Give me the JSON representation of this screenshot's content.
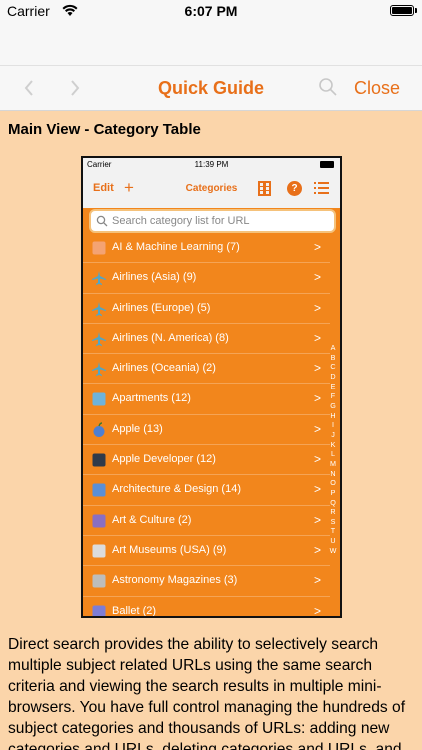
{
  "status_bar": {
    "carrier": "Carrier",
    "time": "6:07 PM"
  },
  "nav": {
    "title": "Quick Guide",
    "close_label": "Close",
    "back_icon": "chevron-left-icon",
    "forward_icon": "chevron-right-icon",
    "search_icon": "search-icon"
  },
  "section": {
    "heading": "Main View - Category Table"
  },
  "screenshot": {
    "status": {
      "carrier": "Carrier",
      "time": "11:39 PM"
    },
    "nav": {
      "edit": "Edit",
      "plus": "+",
      "title": "Categories",
      "help": "?"
    },
    "search_placeholder": "Search category list for URL",
    "rows": [
      {
        "label": "AI & Machine Learning (7)",
        "icon": "ai-icon",
        "color": "#f4a373"
      },
      {
        "label": "Airlines (Asia) (9)",
        "icon": "airplane-icon",
        "color": "#4fa6c9"
      },
      {
        "label": "Airlines (Europe) (5)",
        "icon": "airplane-icon",
        "color": "#4fa6c9"
      },
      {
        "label": "Airlines (N. America) (8)",
        "icon": "airplane-icon",
        "color": "#4fa6c9"
      },
      {
        "label": "Airlines (Oceania) (2)",
        "icon": "airplane-icon",
        "color": "#4fa6c9"
      },
      {
        "label": "Apartments (12)",
        "icon": "building-icon",
        "color": "#6fb3d9"
      },
      {
        "label": "Apple (13)",
        "icon": "apple-icon",
        "color": "#4e7fd1"
      },
      {
        "label": "Apple Developer (12)",
        "icon": "monitor-icon",
        "color": "#2f3a4a"
      },
      {
        "label": "Architecture & Design (14)",
        "icon": "tools-icon",
        "color": "#5b8fd6"
      },
      {
        "label": "Art & Culture (2)",
        "icon": "theater-icon",
        "color": "#8a6fc2"
      },
      {
        "label": "Art Museums (USA) (9)",
        "icon": "museum-icon",
        "color": "#dcdcdc"
      },
      {
        "label": "Astronomy Magazines (3)",
        "icon": "observatory-icon",
        "color": "#bdbdbd"
      },
      {
        "label": "Ballet (2)",
        "icon": "ballet-icon",
        "color": "#7d7dd6"
      }
    ],
    "index_letters": [
      "A",
      "B",
      "C",
      "D",
      "E",
      "F",
      "G",
      "H",
      "I",
      "J",
      "K",
      "L",
      "M",
      "N",
      "O",
      "P",
      "Q",
      "R",
      "S",
      "T",
      "U",
      "W"
    ]
  },
  "body": {
    "paragraph": "Direct search provides the ability to selectively search multiple subject related URLs using the same search criteria and viewing the search results in multiple mini-browsers. You have full control managing the hundreds of subject categories and thousands of URLs: adding new categories and URLs, deleting categories and URLs, and editing each category and URL."
  },
  "colors": {
    "accent": "#e8701a",
    "page_background": "#fbd5aa",
    "table_orange": "#f2861c"
  }
}
